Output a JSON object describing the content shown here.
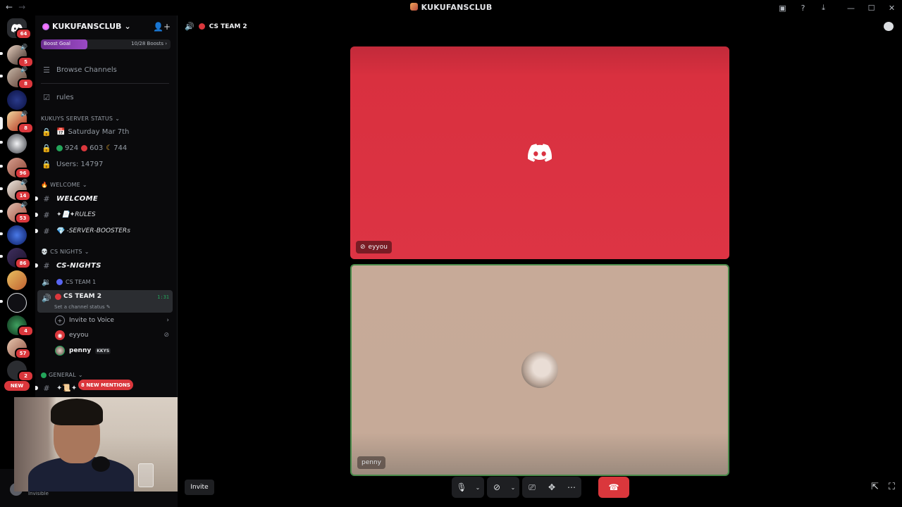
{
  "window": {
    "title": "KUKUFANSCLUB",
    "nav_back": "←",
    "nav_forward": "→",
    "icons": [
      "inbox-icon",
      "help-icon",
      "download-icon",
      "minimize-icon",
      "maximize-icon",
      "close-icon"
    ]
  },
  "rail": {
    "home_badge": "64",
    "new_label": "NEW",
    "badges": [
      "5",
      "8",
      "8",
      "96",
      "14",
      "53",
      "86",
      "4",
      "57",
      "2"
    ]
  },
  "server": {
    "name": "KUKUFANSCLUB",
    "boost_label": "Boost Goal",
    "boost_count": "10/28 Boosts",
    "boost_progress": 0.357
  },
  "channels": {
    "browse": "Browse Channels",
    "rules": "rules",
    "status_category": "KUKUYS SERVER STATUS",
    "date": "Saturday Mar 7th",
    "online_green": "924",
    "online_red": "603",
    "online_moon": "744",
    "users": "Users: 14797",
    "welcome_category": "WELCOME",
    "welcome_channel": "WELCOME",
    "rules_channel": "✦📄✦RULES",
    "boosters_channel": "-SERVER-BOOSTERs",
    "cs_category": "CS NIGHTS",
    "cs_channel": "CS-NIGHTS",
    "team1": "CS TEAM 1",
    "team2": "CS TEAM 2",
    "team2_timer": "1:31",
    "team2_status": "Set a channel status",
    "invite_voice": "Invite to Voice",
    "general_category": "GENERAL",
    "mentions": "8 NEW MENTIONS"
  },
  "members": [
    {
      "name": "eyyou",
      "tag": ""
    },
    {
      "name": "penny",
      "tag": "KKYS"
    }
  ],
  "user": {
    "status": "Invisible"
  },
  "main": {
    "channel_title": "CS TEAM 2",
    "tile_top_name": "eyyou",
    "tile_bottom_name": "penny",
    "invite": "Invite"
  },
  "colors": {
    "accent_red": "#da373c",
    "tile_red": "#dd3444",
    "speaking_green": "#23a55a"
  }
}
